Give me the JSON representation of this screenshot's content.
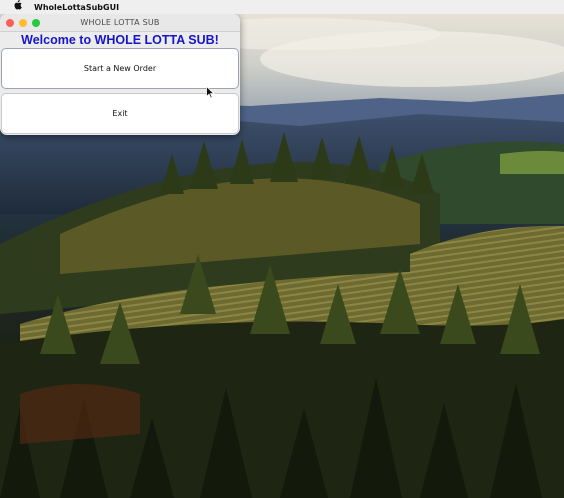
{
  "menubar": {
    "apple_icon": "apple-logo-icon",
    "app_name": "WholeLottaSubGUI"
  },
  "window": {
    "title": "WHOLE LOTTA SUB",
    "heading": "Welcome to WHOLE LOTTA SUB!",
    "heading_color": "#1616c8",
    "buttons": {
      "start_label": "Start a New Order",
      "exit_label": "Exit"
    },
    "traffic_lights": {
      "close_color": "#fe5f57",
      "minimize_color": "#febc2e",
      "zoom_color": "#28c840"
    }
  }
}
